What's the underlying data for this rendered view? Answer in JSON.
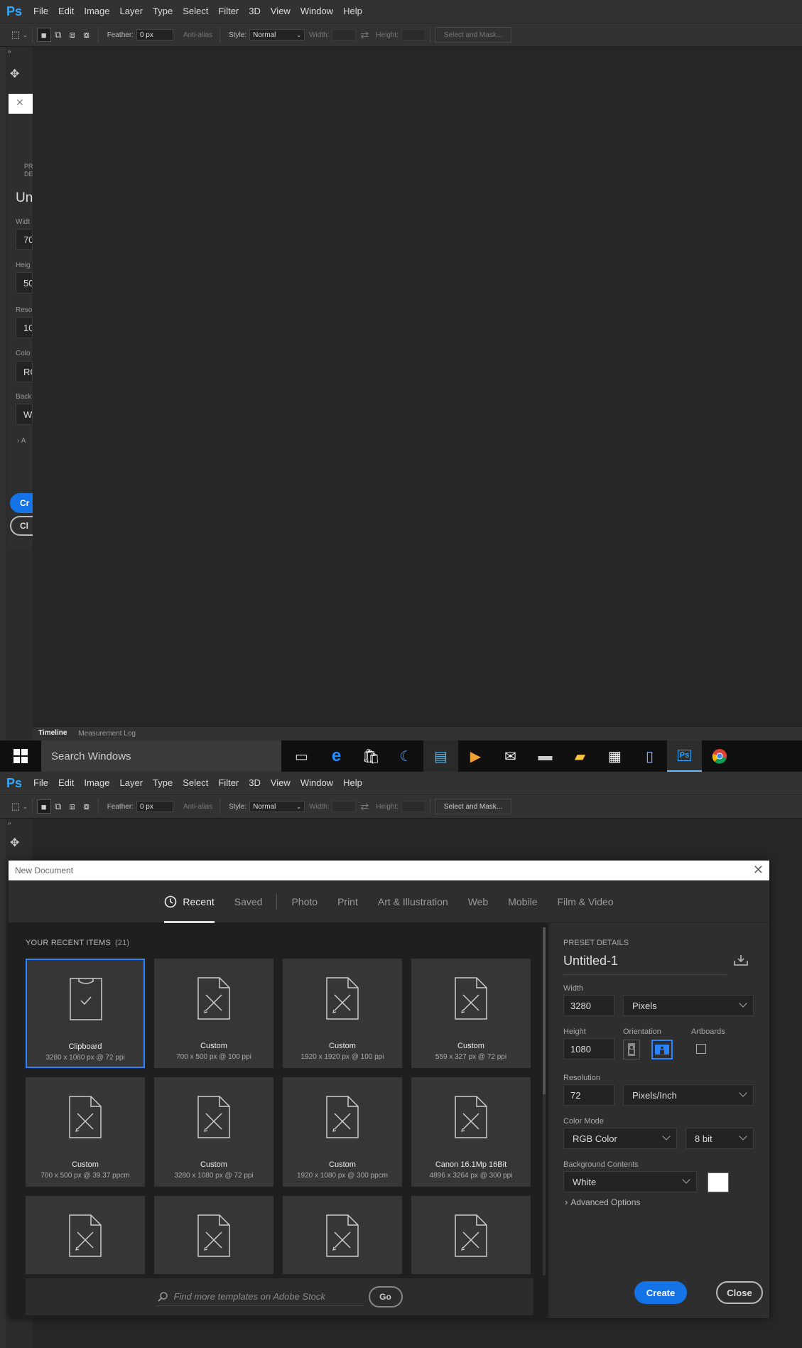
{
  "app": {
    "logo": "Ps"
  },
  "menu": [
    "File",
    "Edit",
    "Image",
    "Layer",
    "Type",
    "Select",
    "Filter",
    "3D",
    "View",
    "Window",
    "Help"
  ],
  "options_bar": {
    "feather_label": "Feather:",
    "feather_value": "0 px",
    "antialias_label": "Anti-alias",
    "style_label": "Style:",
    "style_value": "Normal",
    "width_label": "Width:",
    "height_label": "Height:",
    "select_mask": "Select and Mask..."
  },
  "ghost_dialog": {
    "title_short": "Un",
    "labels": [
      "PR",
      "DE",
      "Widt",
      "Heig",
      "Reso",
      "Colo",
      "Back"
    ],
    "values": [
      "70",
      "50",
      "10",
      "RG",
      "W"
    ],
    "advanced": "A",
    "create": "Cr",
    "close": "Cl"
  },
  "panel_tabs": [
    "Timeline",
    "Measurement Log"
  ],
  "taskbar": {
    "search": "Search Windows",
    "icons": [
      "task-view-icon",
      "edge-icon",
      "store-icon",
      "app-icon",
      "monitor-icon",
      "media-player-icon",
      "mail-icon",
      "terminal-icon",
      "folder-icon",
      "calculator-icon",
      "notes-icon",
      "photoshop-icon",
      "chrome-icon"
    ]
  },
  "dialog": {
    "title": "New Document",
    "tabs": [
      {
        "label": "Recent",
        "active": true
      },
      {
        "label": "Saved",
        "active": false
      },
      {
        "label": "Photo",
        "active": false
      },
      {
        "label": "Print",
        "active": false
      },
      {
        "label": "Art & Illustration",
        "active": false
      },
      {
        "label": "Web",
        "active": false
      },
      {
        "label": "Mobile",
        "active": false
      },
      {
        "label": "Film & Video",
        "active": false
      }
    ],
    "recent_heading": "YOUR RECENT ITEMS",
    "recent_count": "(21)",
    "items": [
      {
        "name": "Clipboard",
        "dims": "3280 x 1080 px @ 72 ppi",
        "selected": true,
        "icon": "clipboard-icon"
      },
      {
        "name": "Custom",
        "dims": "700 x 500 px @ 100 ppi",
        "icon": "custom-doc-icon"
      },
      {
        "name": "Custom",
        "dims": "1920 x 1920 px @ 100 ppi",
        "icon": "custom-doc-icon"
      },
      {
        "name": "Custom",
        "dims": "559 x 327 px @ 72 ppi",
        "icon": "custom-doc-icon"
      },
      {
        "name": "Custom",
        "dims": "700 x 500 px @ 39.37 ppcm",
        "icon": "custom-doc-icon"
      },
      {
        "name": "Custom",
        "dims": "3280 x 1080 px @ 72 ppi",
        "icon": "custom-doc-icon"
      },
      {
        "name": "Custom",
        "dims": "1920 x 1080 px @ 300 ppcm",
        "icon": "custom-doc-icon"
      },
      {
        "name": "Canon 16.1Mp 16Bit",
        "dims": "4896 x 3264 px @ 300 ppi",
        "icon": "custom-doc-icon"
      },
      {
        "name": "",
        "dims": "",
        "icon": "custom-doc-icon"
      },
      {
        "name": "",
        "dims": "",
        "icon": "custom-doc-icon"
      },
      {
        "name": "",
        "dims": "",
        "icon": "custom-doc-icon"
      },
      {
        "name": "",
        "dims": "",
        "icon": "custom-doc-icon"
      }
    ],
    "stock_placeholder": "Find more templates on Adobe Stock",
    "go": "Go",
    "preset": {
      "heading": "PRESET DETAILS",
      "name": "Untitled-1",
      "width_label": "Width",
      "width": "3280",
      "width_unit": "Pixels",
      "height_label": "Height",
      "height": "1080",
      "orientation_label": "Orientation",
      "artboards_label": "Artboards",
      "resolution_label": "Resolution",
      "resolution": "72",
      "resolution_unit": "Pixels/Inch",
      "color_mode_label": "Color Mode",
      "color_mode": "RGB Color",
      "bit_depth": "8 bit",
      "background_label": "Background Contents",
      "background": "White",
      "background_swatch": "#ffffff",
      "advanced": "Advanced Options",
      "create": "Create",
      "close": "Close"
    }
  },
  "colors": {
    "accent": "#1473e6",
    "selection": "#2b84ff",
    "ps_blue": "#31a8ff"
  }
}
